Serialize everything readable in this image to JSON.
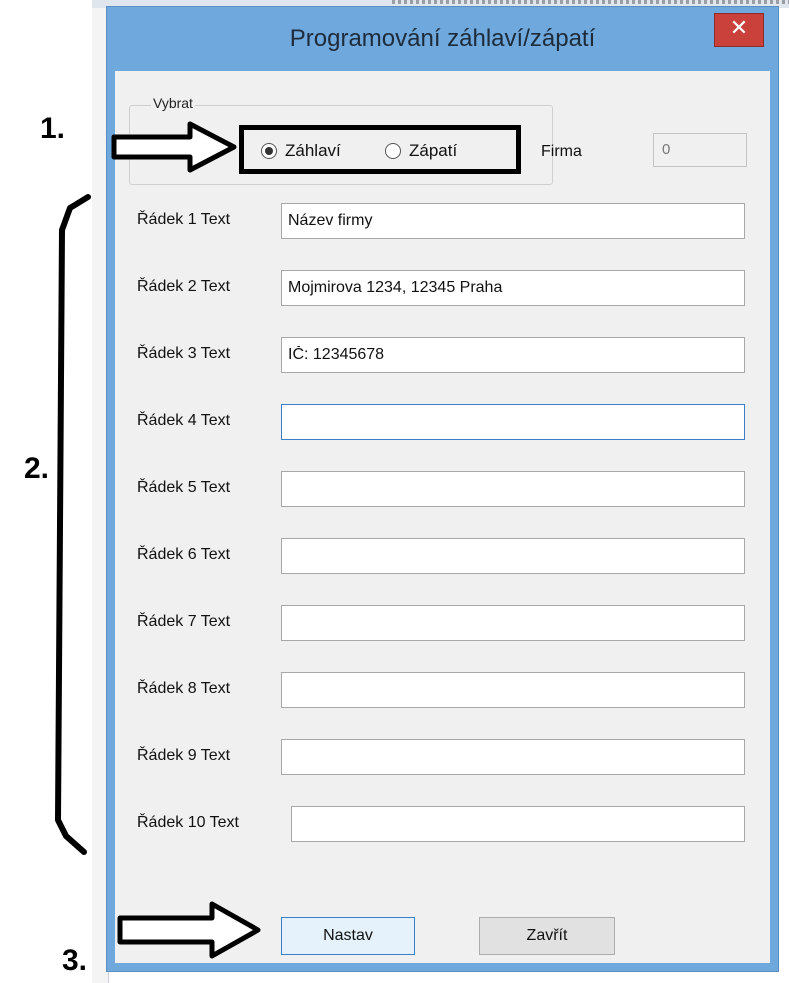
{
  "dialog": {
    "title": "Programování záhlaví/zápatí",
    "close_glyph": "✕"
  },
  "select_group": {
    "legend": "Vybrat",
    "options": [
      {
        "label": "Záhlaví",
        "selected": true
      },
      {
        "label": "Zápatí",
        "selected": false
      }
    ]
  },
  "firma": {
    "label": "Firma",
    "value": "0"
  },
  "rows": [
    {
      "label": "Řádek 1 Text",
      "value": "Název firmy"
    },
    {
      "label": "Řádek 2 Text",
      "value": "Mojmirova 1234, 12345 Praha"
    },
    {
      "label": "Řádek 3 Text",
      "value": "IČ: 12345678"
    },
    {
      "label": "Řádek 4 Text",
      "value": ""
    },
    {
      "label": "Řádek 5 Text",
      "value": ""
    },
    {
      "label": "Řádek 6 Text",
      "value": ""
    },
    {
      "label": "Řádek 7 Text",
      "value": ""
    },
    {
      "label": "Řádek 8 Text",
      "value": ""
    },
    {
      "label": "Řádek 9 Text",
      "value": ""
    },
    {
      "label": "Řádek 10 Text",
      "value": ""
    }
  ],
  "buttons": {
    "set": "Nastav",
    "close": "Zavřít"
  },
  "annotations": {
    "step1": "1.",
    "step2": "2.",
    "step3": "3."
  },
  "colors": {
    "title_bar": "#6fa8dc",
    "close_button": "#c9413a",
    "dialog_body": "#f0f0f0"
  }
}
